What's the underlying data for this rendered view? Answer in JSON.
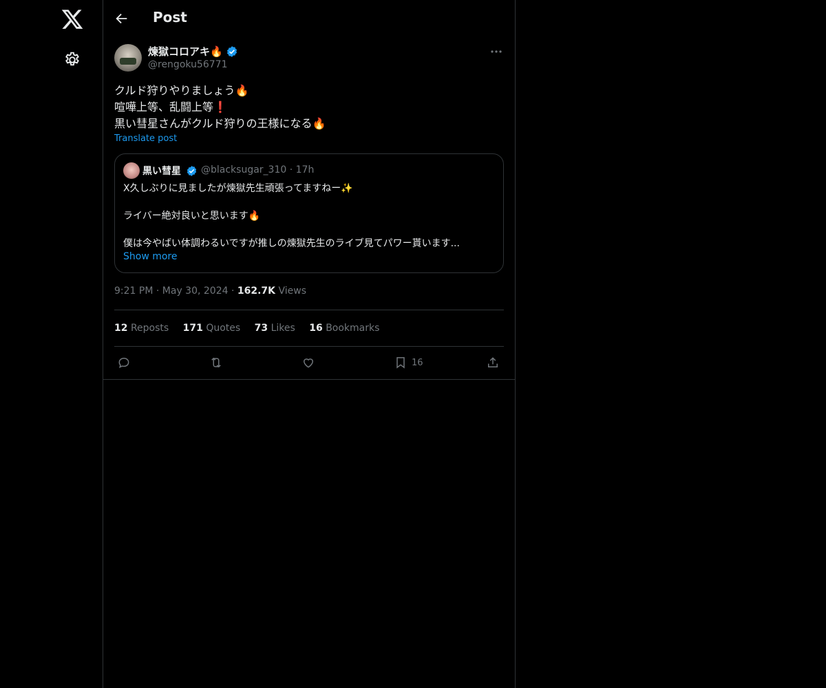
{
  "header": {
    "title": "Post"
  },
  "post": {
    "author_name": "煉獄コロアキ",
    "author_emoji": "🔥",
    "author_handle": "@rengoku56771",
    "lines": [
      "クルド狩りやりましょう🔥",
      "喧嘩上等、乱闘上等❗",
      "黒い彗星さんがクルド狩りの王様になる🔥"
    ],
    "translate_label": "Translate post",
    "time": "9:21 PM",
    "date": "May 30, 2024",
    "views_count": "162.7K",
    "views_label": "Views"
  },
  "quote": {
    "author_name": "黒い彗星",
    "author_handle": "@blacksugar_310",
    "age": "17h",
    "lines": [
      "X久しぶりに見ましたが煉獄先生頑張ってますねー✨",
      "",
      "ライバー絶対良いと思います🔥",
      "",
      "僕は今やばい体調わるいですが推しの煉獄先生のライブ見てパワー貰います..."
    ],
    "show_more_label": "Show more"
  },
  "stats": [
    {
      "count": "12",
      "label": "Reposts"
    },
    {
      "count": "171",
      "label": "Quotes"
    },
    {
      "count": "73",
      "label": "Likes"
    },
    {
      "count": "16",
      "label": "Bookmarks"
    }
  ],
  "actions": {
    "bookmark_count": "16"
  },
  "colors": {
    "accent": "#1d9bf0",
    "muted": "#71767b",
    "border": "#2f3336",
    "background": "#000000"
  },
  "icons": [
    "x-logo-icon",
    "gear-icon",
    "back-arrow-icon",
    "verified-badge-icon",
    "more-icon",
    "reply-icon",
    "repost-icon",
    "like-icon",
    "bookmark-icon",
    "share-icon"
  ]
}
